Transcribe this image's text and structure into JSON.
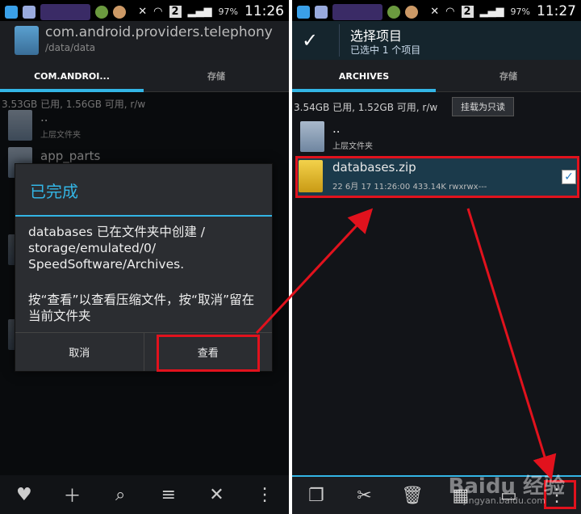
{
  "left": {
    "status": {
      "battery": "97%",
      "time": "11:26",
      "sim": "2"
    },
    "header": {
      "package": "com.android.providers.telephony",
      "path": "/data/data"
    },
    "tabs": [
      {
        "label": "COM.ANDROI..."
      },
      {
        "label": "存储"
      }
    ],
    "storage_info": "3.53GB 已用, 1.56GB 可用, r/w",
    "list": [
      {
        "name": "..",
        "sub": "上层文件夹"
      },
      {
        "name": "app_parts",
        "sub": ""
      }
    ],
    "dialog": {
      "title": "已完成",
      "message": "databases 已在文件夹中创建 / storage/emulated/0/ SpeedSoftware/Archives.",
      "message2": "按“查看”以查看压缩文件，按“取消”留在当前文件夹",
      "cancel": "取消",
      "view": "查看"
    },
    "bottom_icons": [
      "heart-icon",
      "plus-icon",
      "search-icon",
      "sort-icon",
      "close-icon",
      "overflow-icon"
    ]
  },
  "right": {
    "status": {
      "battery": "97%",
      "time": "11:27",
      "sim": "2"
    },
    "header": {
      "title": "选择项目",
      "subtitle": "已选中 1 个项目"
    },
    "tabs": [
      {
        "label": "ARCHIVES"
      },
      {
        "label": "存储"
      }
    ],
    "storage_info": "3.54GB 已用, 1.52GB 可用, r/w",
    "readonly_button": "挂载为只读",
    "list": [
      {
        "name": "..",
        "sub": "上层文件夹"
      },
      {
        "name": "databases.zip",
        "sub": "22 6月 17 11:26:00  433.14K  rwxrwx---"
      }
    ],
    "bottom_icons": [
      "copy-icon",
      "cut-icon",
      "delete-icon",
      "compress-icon",
      "folder-icon",
      "overflow-icon"
    ],
    "watermark": "Baidu 经验",
    "watermark_sub": "jingyan.baidu.com"
  },
  "colors": {
    "accent": "#33b5e5",
    "highlight": "#e1121d"
  }
}
